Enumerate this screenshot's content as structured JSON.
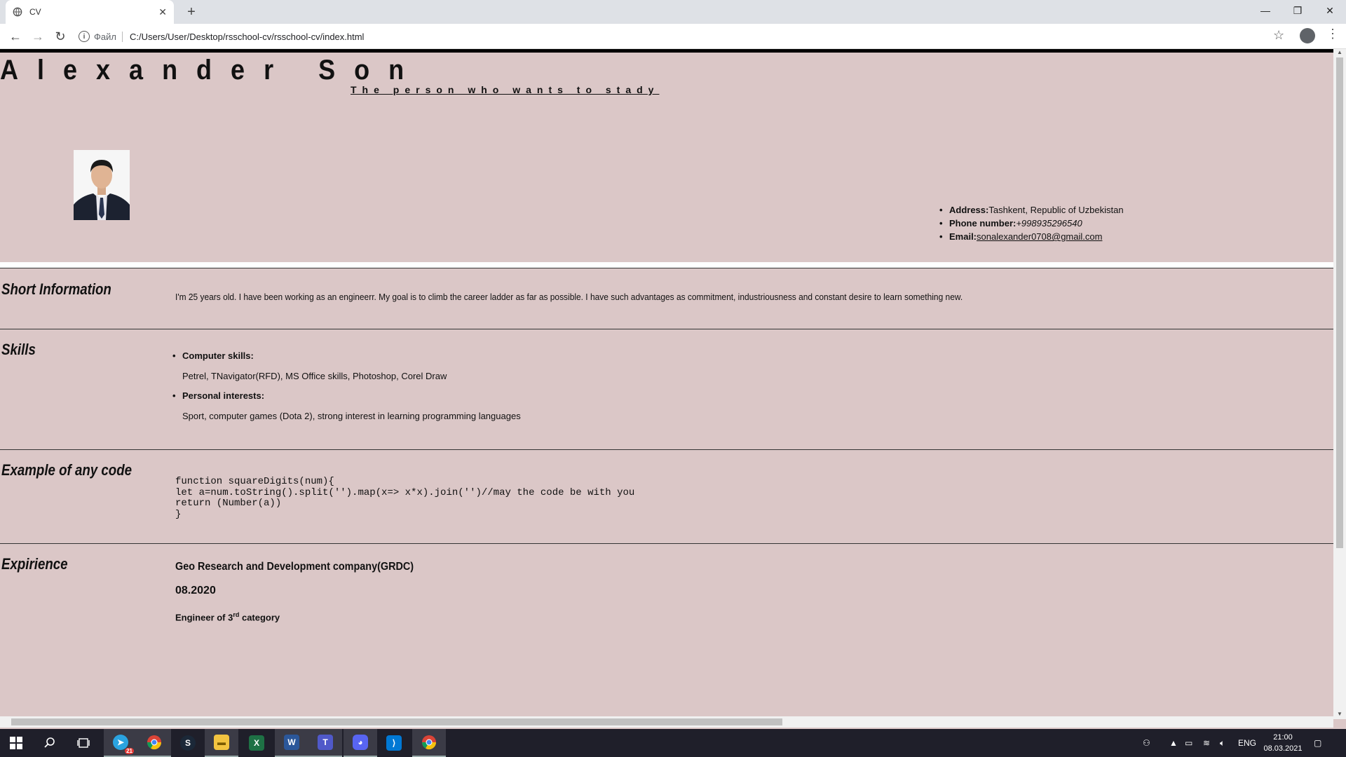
{
  "browser": {
    "tab_title": "CV",
    "new_tab": "+",
    "url_file_label": "Файл",
    "url": "C:/Users/User/Desktop/rsschool-cv/rsschool-cv/index.html"
  },
  "header": {
    "name": "Alexander Son",
    "subtitle": "The person who wants to stady"
  },
  "contacts": {
    "address_label": "Address:",
    "address": "Tashkent, Republic of Uzbekistan",
    "phone_label": "Phone number:",
    "phone": "+998935296540",
    "email_label": "Email:",
    "email": "sonalexander0708@gmail.com"
  },
  "short_info": {
    "title": "Short Information",
    "text": "I'm 25 years old. I have been working as an engineerr. My goal is to climb the career ladder as far as possible. I have such advantages as commitment, industriousness and constant desire to learn something new."
  },
  "skills": {
    "title": "Skills",
    "items": [
      {
        "label": "Computer skills:",
        "text": "Petrel, TNavigator(RFD), MS Office skills, Photoshop, Corel Draw"
      },
      {
        "label": "Personal interests:",
        "text": "Sport, computer games (Dota 2), strong interest in learning programming languages"
      }
    ]
  },
  "code": {
    "title": "Example of any code",
    "lines": [
      "function squareDigits(num){",
      "let a=num.toString().split('').map(x=> x*x).join('')//may the code be with you",
      "return (Number(a))",
      "}"
    ]
  },
  "experience": {
    "title": "Expirience",
    "company": "Geo Research and Development company(GRDC)",
    "date": "08.2020",
    "role_prefix": "Engineer of 3",
    "role_sup": "rd",
    "role_suffix": " category"
  },
  "taskbar": {
    "telegram_badge": "21",
    "lang": "ENG",
    "time": "21:00",
    "date": "08.03.2021"
  },
  "colors": {
    "page_bg": "#dbc7c7",
    "taskbar_bg": "#1f1f2a"
  }
}
